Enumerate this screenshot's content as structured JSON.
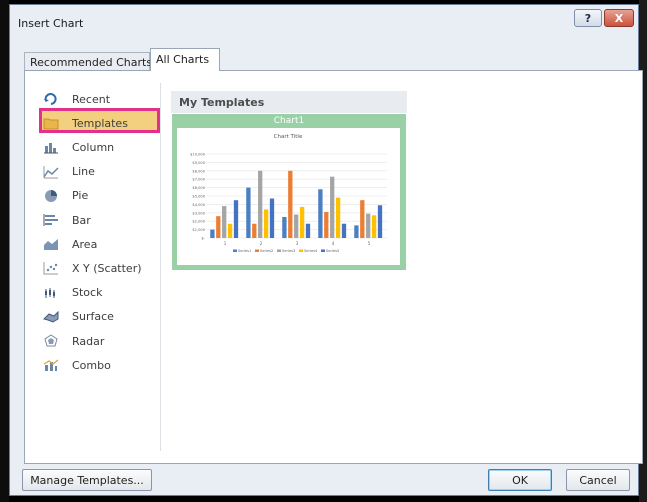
{
  "window": {
    "title": "Insert Chart",
    "help_label": "?",
    "close_label": "X"
  },
  "tabs": [
    {
      "label": "Recommended Charts"
    },
    {
      "label": "All Charts"
    }
  ],
  "categories": [
    {
      "label": "Recent",
      "icon": "recent-icon"
    },
    {
      "label": "Templates",
      "icon": "folder-icon"
    },
    {
      "label": "Column",
      "icon": "column-chart-icon"
    },
    {
      "label": "Line",
      "icon": "line-chart-icon"
    },
    {
      "label": "Pie",
      "icon": "pie-chart-icon"
    },
    {
      "label": "Bar",
      "icon": "bar-chart-icon"
    },
    {
      "label": "Area",
      "icon": "area-chart-icon"
    },
    {
      "label": "X Y (Scatter)",
      "icon": "scatter-chart-icon"
    },
    {
      "label": "Stock",
      "icon": "stock-chart-icon"
    },
    {
      "label": "Surface",
      "icon": "surface-chart-icon"
    },
    {
      "label": "Radar",
      "icon": "radar-chart-icon"
    },
    {
      "label": "Combo",
      "icon": "combo-chart-icon"
    }
  ],
  "selected_category": "Templates",
  "main": {
    "group_title": "My Templates",
    "template": {
      "name": "Chart1",
      "chart_title": "Chart Title",
      "y_ticks": [
        "$10,000",
        "$9,000",
        "$8,000",
        "$7,000",
        "$6,000",
        "$5,000",
        "$4,000",
        "$3,000",
        "$2,000",
        "$1,000",
        "$-"
      ],
      "categories": [
        "1",
        "2",
        "3",
        "4",
        "5"
      ],
      "series": [
        {
          "name": "Series1",
          "color": "#4a7fc4",
          "values": [
            1000,
            6000,
            2500,
            5800,
            1500
          ]
        },
        {
          "name": "Series2",
          "color": "#ed7d31",
          "values": [
            2600,
            1700,
            8000,
            3100,
            4500
          ]
        },
        {
          "name": "Series3",
          "color": "#a5a5a5",
          "values": [
            3800,
            8000,
            2800,
            7300,
            2900
          ]
        },
        {
          "name": "Series4",
          "color": "#ffc000",
          "values": [
            1700,
            3400,
            3700,
            4800,
            2700
          ]
        },
        {
          "name": "Series5",
          "color": "#4472c4",
          "values": [
            4500,
            4700,
            1700,
            1700,
            3900
          ]
        }
      ]
    }
  },
  "chart_data": {
    "type": "bar",
    "title": "Chart Title",
    "categories": [
      "1",
      "2",
      "3",
      "4",
      "5"
    ],
    "ylim": [
      0,
      10000
    ],
    "series": [
      {
        "name": "Series1",
        "values": [
          1000,
          6000,
          2500,
          5800,
          1500
        ]
      },
      {
        "name": "Series2",
        "values": [
          2600,
          1700,
          8000,
          3100,
          4500
        ]
      },
      {
        "name": "Series3",
        "values": [
          3800,
          8000,
          2800,
          7300,
          2900
        ]
      },
      {
        "name": "Series4",
        "values": [
          1700,
          3400,
          3700,
          4800,
          2700
        ]
      },
      {
        "name": "Series5",
        "values": [
          4500,
          4700,
          1700,
          1700,
          3900
        ]
      }
    ],
    "legend": "bottom"
  },
  "footer": {
    "manage_label": "Manage Templates...",
    "ok_label": "OK",
    "cancel_label": "Cancel"
  },
  "colors": {
    "highlight": "#e2308b",
    "thumbnail_frame": "#99d0a6",
    "selected_bg": "#f2d07f"
  }
}
